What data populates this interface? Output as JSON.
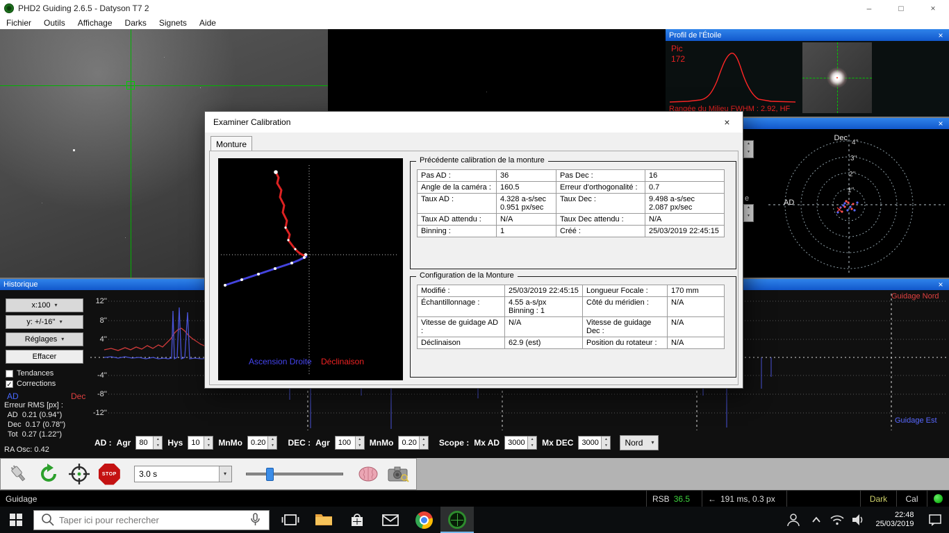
{
  "window": {
    "title": "PHD2 Guiding 2.6.5 - Datyson T7 2",
    "menus": [
      "Fichier",
      "Outils",
      "Affichage",
      "Darks",
      "Signets",
      "Aide"
    ]
  },
  "icons": {
    "close": "×",
    "minimize": "–",
    "maximize": "□",
    "dropdown": "▾",
    "spinner_up": "▲",
    "spinner_down": "▼",
    "left_arrow": "←",
    "check": "✓"
  },
  "colors": {
    "caption_blue": "#1e6fdd",
    "trace_red": "#d23b3b",
    "trace_blue": "#4953d8",
    "status_green": "#22c322",
    "rsb_green": "#3ed43e",
    "dark_gold": "#cdd069"
  },
  "panels": {
    "star_profile": {
      "title": "Profil de l'Étoile",
      "peak_label": "Pic",
      "peak_value": "172",
      "fwhm_text": "Rangée du Milieu FWHM : 2.92, HF"
    },
    "target": {
      "dec_label": "Dec",
      "ad_label": "AD",
      "rings": [
        "4''",
        "3''",
        "2''",
        "1''"
      ],
      "edge_fragment": "e"
    },
    "history": {
      "title": "Historique",
      "x_scale_button": "x:100",
      "y_scale_button": "y: +/-16''",
      "settings_button": "Réglages",
      "clear_button": "Effacer",
      "trend_checkbox": "Tendances",
      "corrections_checkbox": "Corrections",
      "ad_legend": "AD",
      "dec_legend": "Dec",
      "rms_title": "Erreur RMS [px] :",
      "rms_ad": " AD  0.21 (0.94'')",
      "rms_dec": " Dec  0.17 (0.78'')",
      "rms_tot": " Tot  0.27 (1.22'')",
      "ra_osc": "RA Osc: 0.42",
      "y_ticks": [
        "12''",
        "8''",
        "4''",
        "-4''",
        "-8''",
        "-12''"
      ],
      "guide_north": "Guidage Nord",
      "guide_east": "Guidage Est"
    }
  },
  "dialog": {
    "title": "Examiner Calibration",
    "tab": "Monture",
    "plot": {
      "ra_axis": "Ascension Droite",
      "dec_axis": "Déclinaison"
    },
    "prev_calibration": {
      "title": "Précédente calibration de la monture",
      "rows": [
        [
          "Pas AD :",
          "36",
          "Pas Dec :",
          "16"
        ],
        [
          "Angle de la caméra :",
          "160.5",
          "Erreur d'orthogonalité :",
          "0.7"
        ],
        [
          "Taux AD :",
          "4.328 a-s/sec\n0.951 px/sec",
          "Taux Dec :",
          "9.498 a-s/sec\n2.087 px/sec"
        ],
        [
          "Taux AD attendu :",
          "N/A",
          "Taux Dec attendu :",
          "N/A"
        ],
        [
          "Binning :",
          "1",
          "Créé :",
          "25/03/2019 22:45:15"
        ]
      ]
    },
    "mount_config": {
      "title": "Configuration de la Monture",
      "rows": [
        [
          "Modifié :",
          "25/03/2019 22:45:15",
          "Longueur Focale :",
          "170 mm"
        ],
        [
          "Échantillonnage :",
          "4.55 a-s/px\nBinning : 1",
          "Côté du méridien :",
          "N/A"
        ],
        [
          "Vitesse de guidage AD :",
          "N/A",
          "Vitesse de guidage Dec :",
          "N/A"
        ],
        [
          "Déclinaison",
          "62.9 (est)",
          "Position du rotateur :",
          "N/A"
        ]
      ]
    }
  },
  "guide_params": {
    "ad_label": "AD :",
    "agr_label": "Agr",
    "agr_value": "80",
    "hys_label": "Hys",
    "hys_value": "10",
    "mnmo_label": "MnMo",
    "mnmo_value": "0.20",
    "dec_label": "DEC :",
    "dec_agr_label": "Agr",
    "dec_agr_value": "100",
    "dec_mnmo_label": "MnMo",
    "dec_mnmo_value": "0.20",
    "scope_label": "Scope :",
    "mxad_label": "Mx AD",
    "mxad_value": "3000",
    "mxdec_label": "Mx DEC",
    "mxdec_value": "3000",
    "direction_value": "Nord"
  },
  "toolbar": {
    "exposure_value": "3.0 s",
    "stop_label": "STOP"
  },
  "statusbar": {
    "state": "Guidage",
    "rsb_label": "RSB",
    "rsb_value": "36.5",
    "timing": "191 ms, 0.3 px",
    "dark_label": "Dark",
    "cal_label": "Cal"
  },
  "taskbar": {
    "search_placeholder": "Taper ici pour rechercher",
    "time": "22:48",
    "date": "25/03/2019"
  }
}
